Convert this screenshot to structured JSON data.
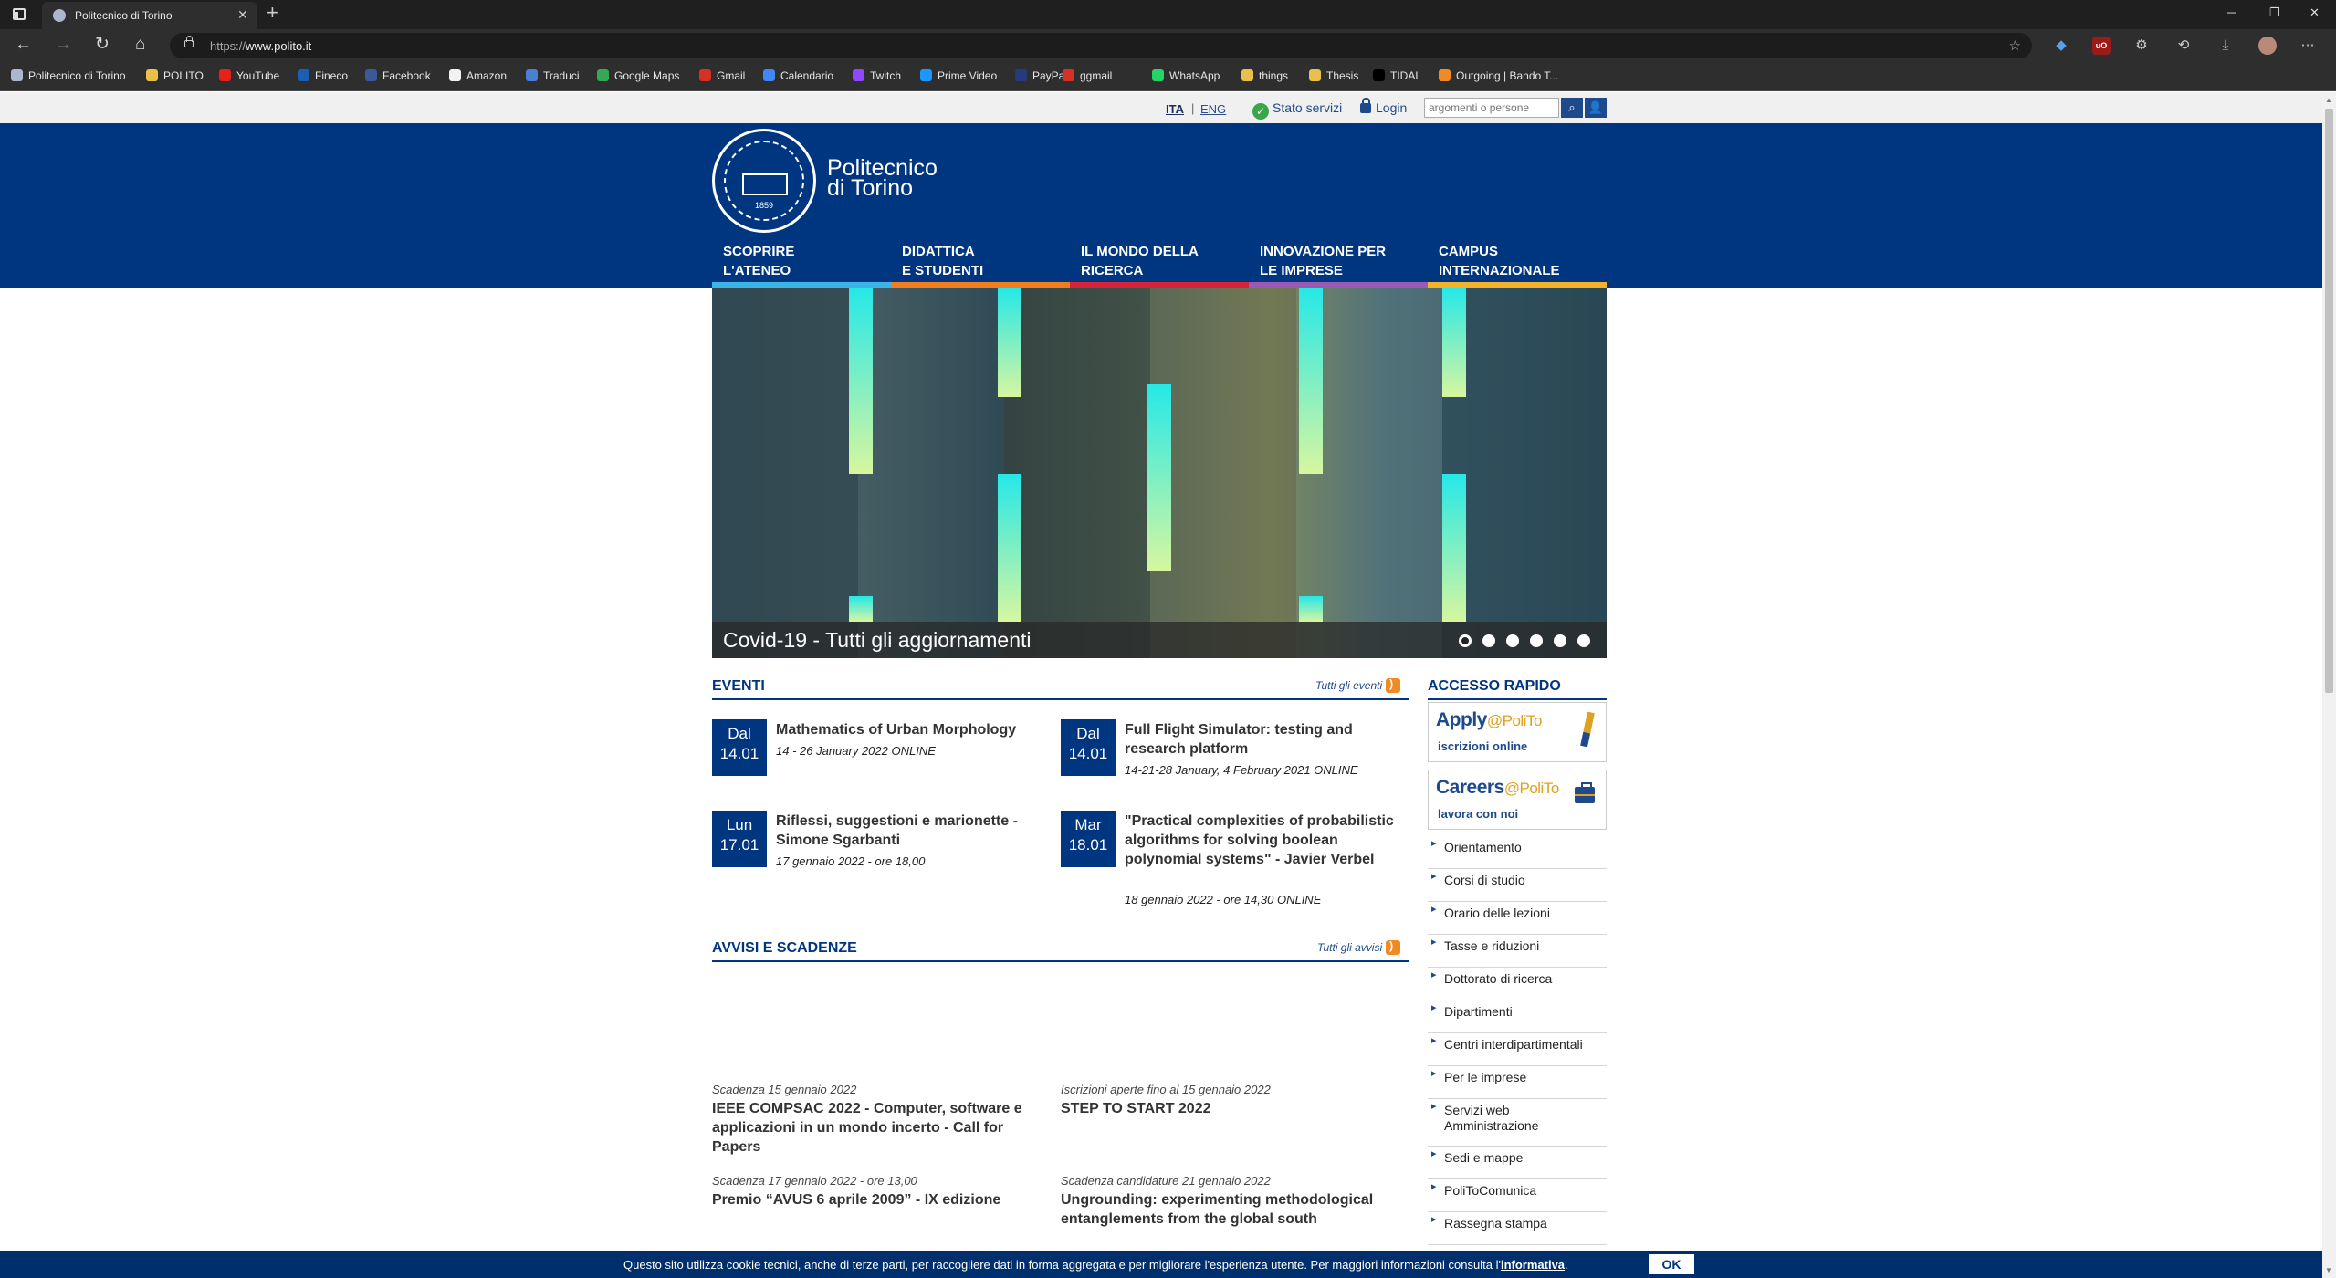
{
  "browser": {
    "tab_title": "Politecnico di Torino",
    "url_prefix": "https://",
    "url_host": "www.polito.it",
    "bookmarks": [
      {
        "label": "Politecnico di Torino",
        "icon": "polito-icon",
        "color": "#aab7cf"
      },
      {
        "label": "POLITO",
        "icon": "folder-icon",
        "color": "#e8c04a"
      },
      {
        "label": "YouTube",
        "icon": "youtube-icon",
        "color": "#e62117"
      },
      {
        "label": "Fineco",
        "icon": "fineco-icon",
        "color": "#1a5fb4"
      },
      {
        "label": "Facebook",
        "icon": "facebook-icon",
        "color": "#3b5998"
      },
      {
        "label": "Amazon",
        "icon": "amazon-icon",
        "color": "#f2f2f2"
      },
      {
        "label": "Traduci",
        "icon": "translate-icon",
        "color": "#4a7fd4"
      },
      {
        "label": "Google Maps",
        "icon": "maps-icon",
        "color": "#34a853"
      },
      {
        "label": "Gmail",
        "icon": "gmail-icon",
        "color": "#d93025"
      },
      {
        "label": "Calendario",
        "icon": "calendar-icon",
        "color": "#4285f4"
      },
      {
        "label": "Twitch",
        "icon": "twitch-icon",
        "color": "#9146ff"
      },
      {
        "label": "Prime Video",
        "icon": "prime-video-icon",
        "color": "#1a98ff"
      },
      {
        "label": "PayPal",
        "icon": "paypal-icon",
        "color": "#253b80"
      },
      {
        "label": "ggmail",
        "icon": "gmail-icon",
        "color": "#d93025"
      },
      {
        "label": "WhatsApp",
        "icon": "whatsapp-icon",
        "color": "#25d366"
      },
      {
        "label": "things",
        "icon": "folder-icon",
        "color": "#e8c04a"
      },
      {
        "label": "Thesis",
        "icon": "folder-icon",
        "color": "#e8c04a"
      },
      {
        "label": "TIDAL",
        "icon": "tidal-icon",
        "color": "#000000"
      },
      {
        "label": "Outgoing | Bando T...",
        "icon": "outgoing-icon",
        "color": "#f08a24"
      }
    ]
  },
  "utility": {
    "lang_ita": "ITA",
    "lang_sep": "|",
    "lang_eng": "ENG",
    "stato": "Stato servizi",
    "login": "Login",
    "search_placeholder": "argomenti o persone"
  },
  "header": {
    "logo_line1": "Politecnico",
    "logo_line2": "di Torino",
    "seal_year": "1859",
    "menu": [
      {
        "label": "SCOPRIRE\nL'ATENEO",
        "color": "#3cb4e6"
      },
      {
        "label": "DIDATTICA\nE STUDENTI",
        "color": "#f07d1e"
      },
      {
        "label": "IL MONDO DELLA\nRICERCA",
        "color": "#d6223a"
      },
      {
        "label": "INNOVAZIONE PER\nLE IMPRESE",
        "color": "#9b59b6"
      },
      {
        "label": "CAMPUS\nINTERNAZIONALE",
        "color": "#f2b32a"
      }
    ]
  },
  "slider": {
    "caption": "Covid-19 - Tutti gli aggiornamenti",
    "slide_count": 6,
    "active_index": 0
  },
  "eventi": {
    "title": "EVENTI",
    "all_link": "Tutti gli eventi",
    "items": [
      {
        "day": "Dal",
        "date": "14.01",
        "title": "Mathematics of Urban Morphology",
        "meta": "14 - 26 January 2022 ONLINE"
      },
      {
        "day": "Dal",
        "date": "14.01",
        "title": "Full Flight Simulator: testing and research platform",
        "meta": "14-21-28 January, 4 February 2021 ONLINE"
      },
      {
        "day": "Lun",
        "date": "17.01",
        "title": "Riflessi, suggestioni e marionette - Simone Sgarbanti",
        "meta": "17 gennaio 2022 - ore 18,00"
      },
      {
        "day": "Mar",
        "date": "18.01",
        "title": "\"Practical complexities of probabilistic algorithms for solving boolean polynomial systems\" - Javier Verbel",
        "meta": "18 gennaio 2022 - ore 14,30 ONLINE"
      }
    ]
  },
  "avvisi": {
    "title": "AVVISI E SCADENZE",
    "all_link": "Tutti gli avvisi",
    "items": [
      {
        "meta": "Scadenza 15 gennaio 2022",
        "title": "IEEE COMPSAC 2022 - Computer, software e applicazioni in un mondo incerto - Call for Papers"
      },
      {
        "meta": "Iscrizioni aperte fino al 15 gennaio 2022",
        "title": "STEP TO START 2022"
      },
      {
        "meta": "Scadenza 17 gennaio 2022 - ore 13,00",
        "title": "Premio “AVUS 6 aprile 2009” - IX edizione"
      },
      {
        "meta": "Scadenza candidature 21 gennaio 2022",
        "title": "Ungrounding: experimenting methodological entanglements from the global south"
      }
    ]
  },
  "accesso": {
    "title": "ACCESSO RAPIDO",
    "apply_big": "Apply",
    "apply_suffix": "@PoliTo",
    "apply_small": "iscrizioni online",
    "careers_big": "Careers",
    "careers_suffix": "@PoliTo",
    "careers_small": "lavora con noi",
    "links": [
      "Orientamento",
      "Corsi di studio",
      "Orario delle lezioni",
      "Tasse e riduzioni",
      "Dottorato di ricerca",
      "Dipartimenti",
      "Centri interdipartimentali",
      "Per le imprese",
      "Servizi web Amministrazione",
      "Sedi e mappe",
      "PoliToComunica",
      "Rassegna stampa"
    ]
  },
  "cookie": {
    "message": "Questo sito utilizza cookie tecnici, anche di terze parti, per raccogliere dati in forma aggregata e per migliorare l'esperienza utente. Per maggiori informazioni consulta l'",
    "link": "informativa",
    "suffix": ".",
    "ok": "OK"
  }
}
